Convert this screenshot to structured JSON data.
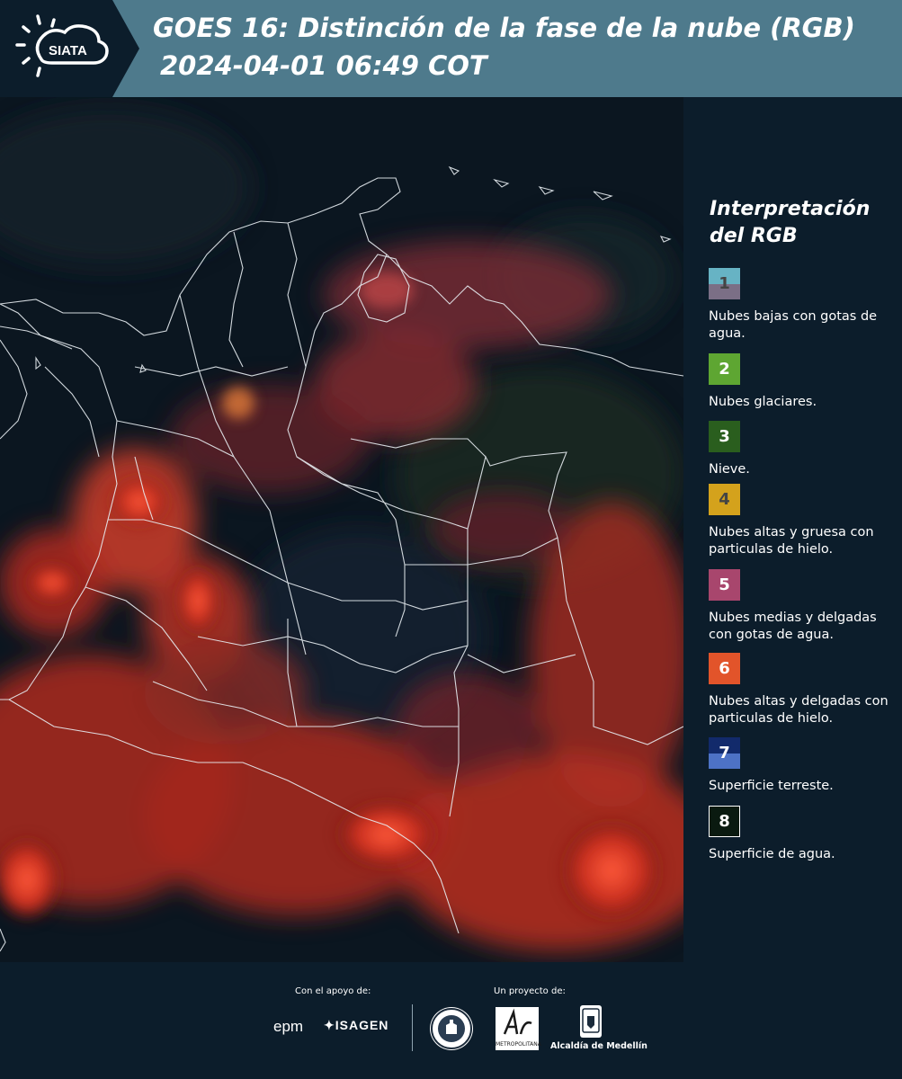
{
  "header": {
    "logo_text": "SIATA",
    "title": "GOES 16: Distinción de la fase de la nube (RGB)",
    "timestamp": "2024-04-01 06:49 COT",
    "background_color": "#4e7a8c"
  },
  "legend": {
    "title": "Interpretación del RGB",
    "items": [
      {
        "number": "1",
        "label": "Nubes bajas con gotas de agua.",
        "color_top": "#67b3c4",
        "color_bottom": "#7b6f86"
      },
      {
        "number": "2",
        "label": "Nubes glaciares.",
        "color_top": "#5ea632",
        "color_bottom": "#5ea632"
      },
      {
        "number": "3",
        "label": "Nieve.",
        "color_top": "#2a5e1e",
        "color_bottom": "#2a5e1e"
      },
      {
        "number": "4",
        "label": "Nubes altas y gruesa con particulas de hielo.",
        "color_top": "#d4a21c",
        "color_bottom": "#d4a21c"
      },
      {
        "number": "5",
        "label": "Nubes medias y delgadas con gotas de agua.",
        "color_top": "#a8466d",
        "color_bottom": "#a8466d"
      },
      {
        "number": "6",
        "label": "Nubes altas y delgadas con particulas de hielo.",
        "color_top": "#e2542a",
        "color_bottom": "#e2542a"
      },
      {
        "number": "7",
        "label": "Superficie terreste.",
        "color_top": "#122a6b",
        "color_bottom": "#4d72c5"
      },
      {
        "number": "8",
        "label": "Superficie de agua.",
        "color_top": "#0a1a10",
        "color_bottom": "#0a1a10"
      }
    ]
  },
  "footer": {
    "support_label": "Con el apoyo de:",
    "project_label": "Un proyecto de:",
    "sponsor_epm": "epm",
    "sponsor_isagen": "ISAGEN",
    "area_text": "METROPOLITANA",
    "alcaldia_label": "Alcaldía de Medellín"
  }
}
